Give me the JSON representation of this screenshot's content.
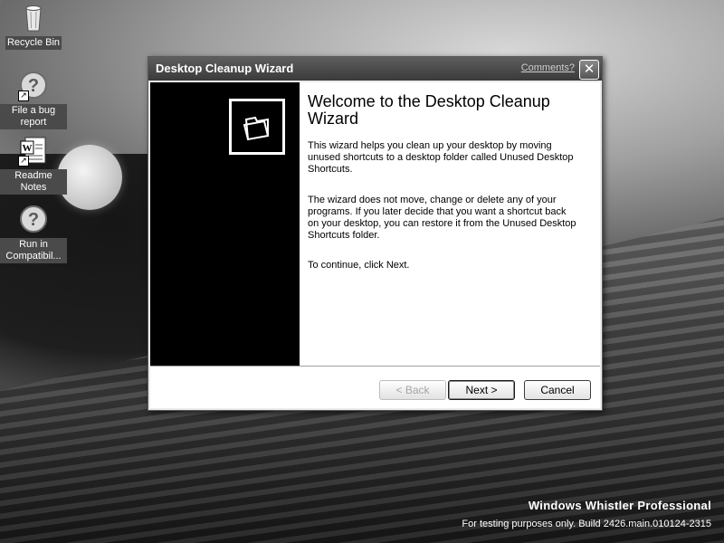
{
  "desktop": {
    "icons": [
      {
        "label": "Recycle Bin",
        "icon": "recycle-bin-icon"
      },
      {
        "label": "File a bug report",
        "icon": "help-icon"
      },
      {
        "label": "Readme Notes",
        "icon": "word-document-icon"
      },
      {
        "label": "Run in Compatibil...",
        "icon": "help-icon"
      }
    ],
    "watermark": {
      "line1": "Windows Whistler Professional",
      "line2": "For testing purposes only. Build 2426.main.010124-2315"
    }
  },
  "wizard": {
    "title": "Desktop Cleanup Wizard",
    "comments_link": "Comments?",
    "close_label": "✕",
    "heading": "Welcome to the Desktop Cleanup Wizard",
    "paragraphs": [
      "This wizard helps you clean up your desktop by moving unused shortcuts to a desktop folder called Unused Desktop Shortcuts.",
      "The wizard does not move, change or delete any of your programs. If you later decide that you want a shortcut back on your desktop, you can restore it from the Unused Desktop Shortcuts folder.",
      "To continue, click Next."
    ],
    "buttons": {
      "back": "< Back",
      "next": "Next >",
      "cancel": "Cancel"
    },
    "folder_icon": "folder-icon"
  }
}
